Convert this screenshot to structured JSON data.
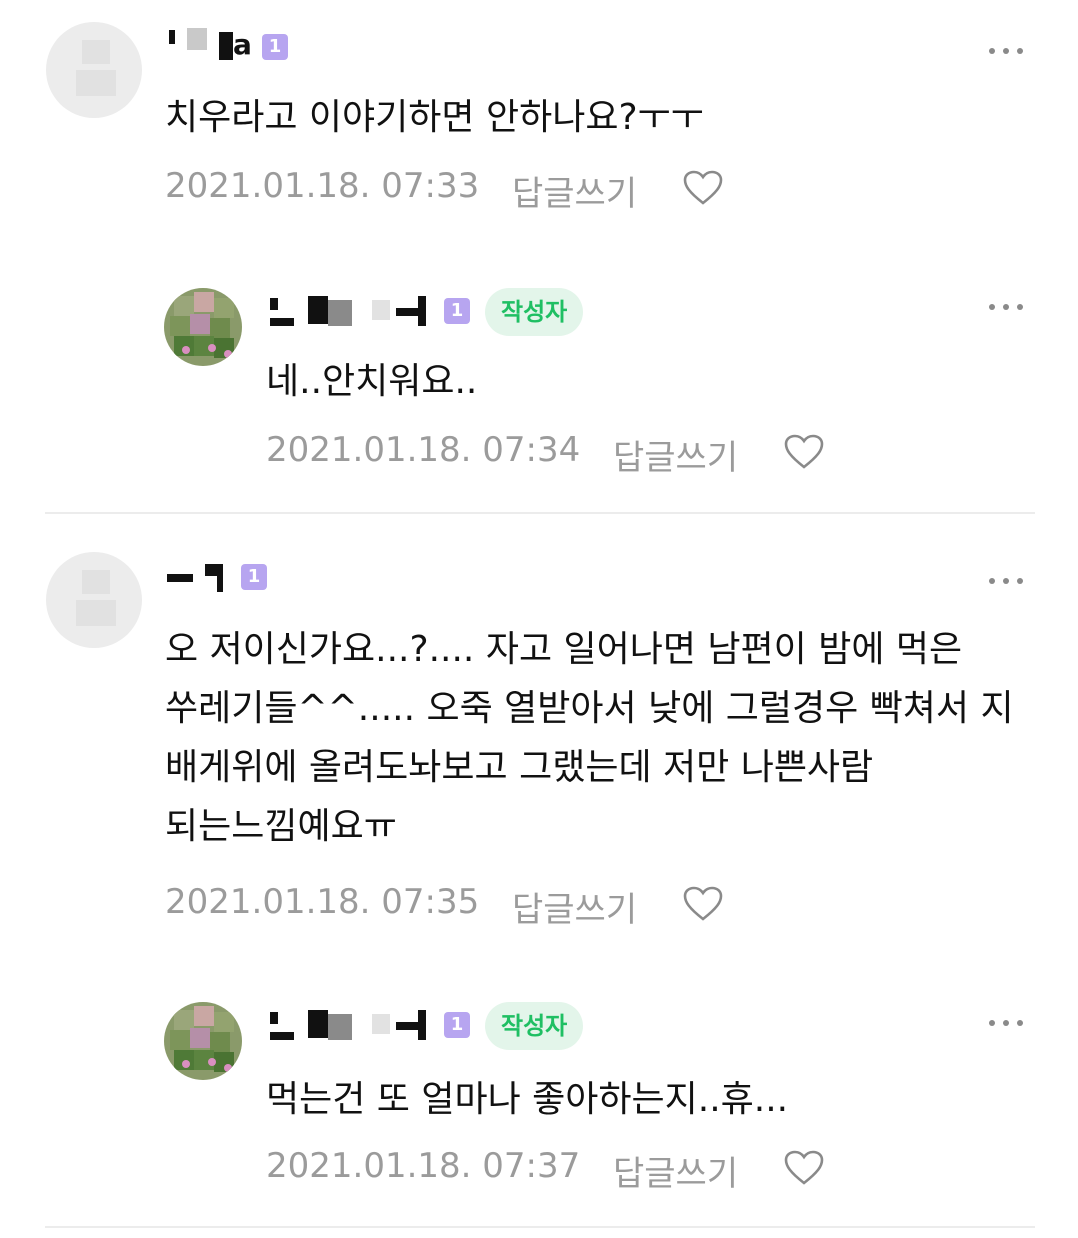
{
  "reply_label": "답글쓰기",
  "author_badge": "작성자",
  "level": "1",
  "colors": {
    "author_badge_bg": "#e3f5ea",
    "author_badge_text": "#1fbf63",
    "level_badge": "#b7a5f0",
    "meta": "#9b9b9b"
  },
  "comments": [
    {
      "nickname_visible": "a",
      "text": "치우라고 이야기하면 안하나요?ㅜㅜ",
      "date": "2021.01.18. 07:33"
    },
    {
      "text": "네..안치워요..",
      "date": "2021.01.18. 07:34"
    },
    {
      "text": "오 저이신가요...?.... 자고 일어나면 남편이 밤에 먹은 쑤레기들^^..... 오죽 열받아서 낮에 그럴경우 빡쳐서 지 배게위에 올려도놔보고 그랬는데 저만 나쁜사람 되는느낌예요ㅠ",
      "date": "2021.01.18. 07:35"
    },
    {
      "text": "먹는건 또 얼마나 좋아하는지..휴...",
      "date": "2021.01.18. 07:37"
    }
  ]
}
